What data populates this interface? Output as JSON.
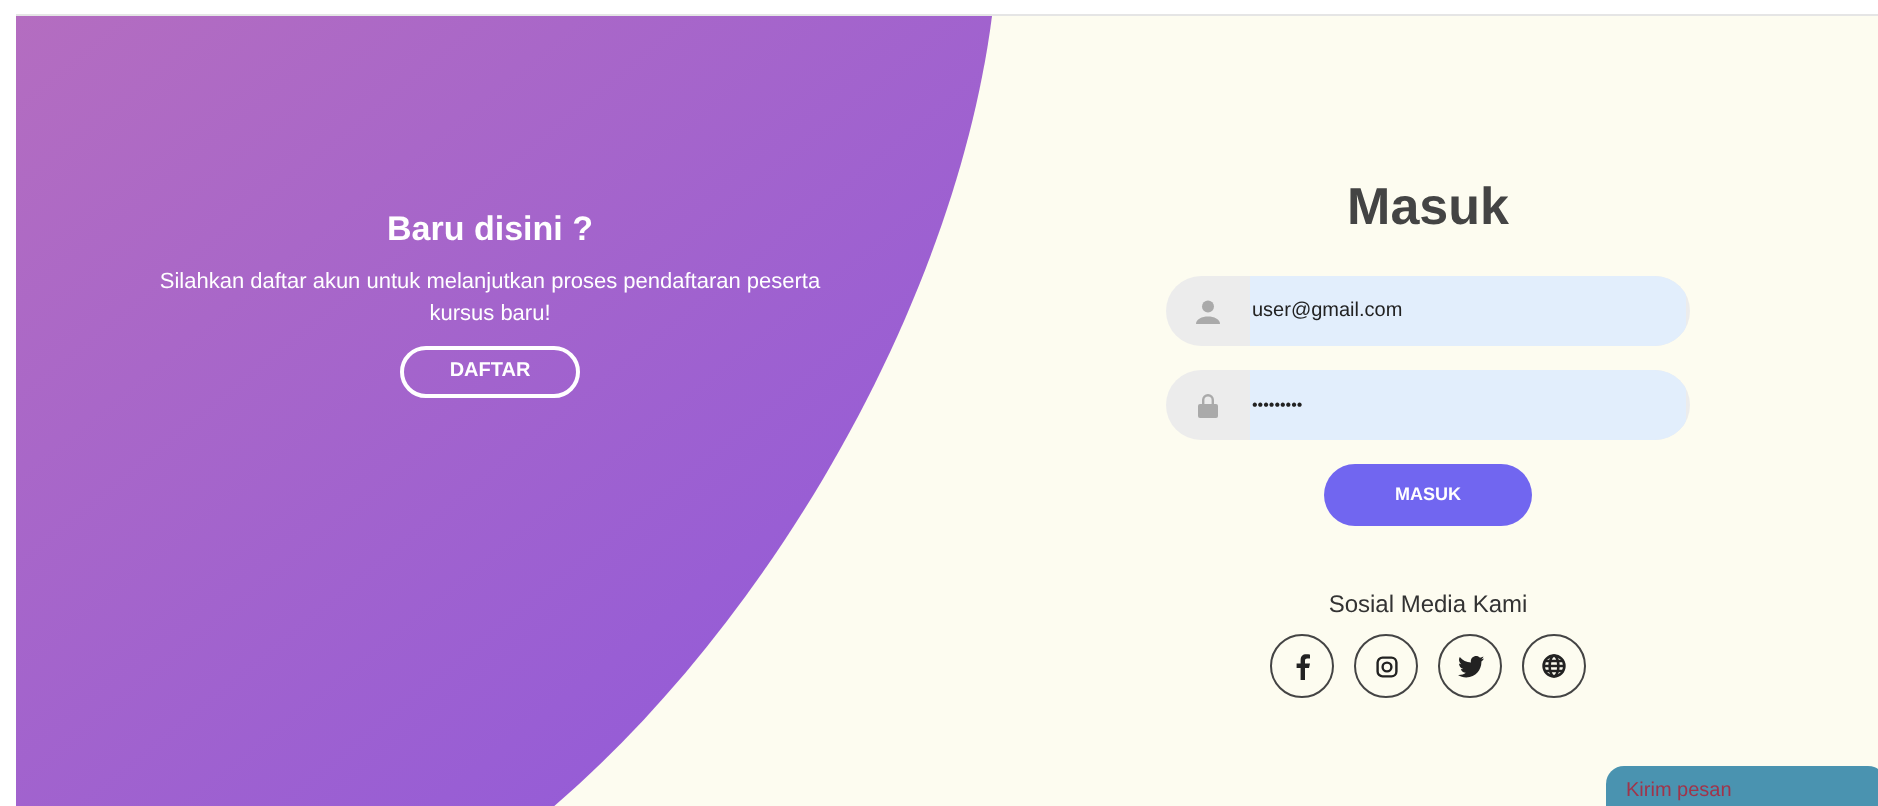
{
  "signup_panel": {
    "title": "Baru disini ?",
    "text": "Silahkan daftar akun untuk melanjutkan proses pendaftaran peserta kursus baru!",
    "button": "DAFTAR"
  },
  "login": {
    "title": "Masuk",
    "fields": [
      {
        "kind": "user",
        "value": "user@gmail.com"
      },
      {
        "kind": "password",
        "value": "•••••••••"
      }
    ],
    "button": "MASUK"
  },
  "social": {
    "title": "Sosial Media Kami",
    "links": [
      {
        "kind": "facebook"
      },
      {
        "kind": "instagram"
      },
      {
        "kind": "twitter"
      },
      {
        "kind": "web"
      }
    ]
  },
  "chat_widget": {
    "label": "Kirim pesan"
  }
}
